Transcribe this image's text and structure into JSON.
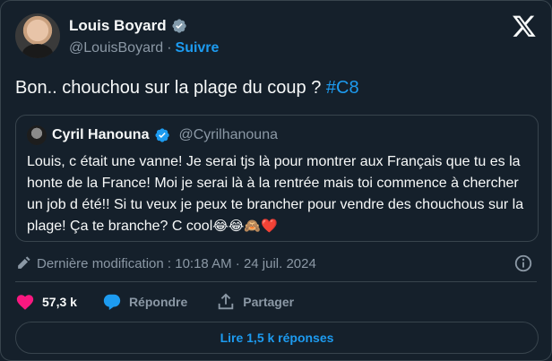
{
  "author": {
    "display_name": "Louis Boyard",
    "handle": "@LouisBoyard",
    "separator": "·",
    "follow_label": "Suivre"
  },
  "tweet": {
    "text": "Bon.. chouchou sur la plage du coup ? ",
    "hashtag": "#C8"
  },
  "quote": {
    "display_name": "Cyril Hanouna",
    "handle": "@Cyrilhanouna",
    "text": "Louis, c était une vanne! Je serai tjs là pour montrer aux Français que tu es la honte de la France! Moi je serai là à la rentrée mais toi commence à chercher un job d été!! Si tu veux je peux te brancher pour vendre des chouchous sur la plage! Ça te branche? C cool",
    "emojis": [
      "😂",
      "😂",
      "🙈",
      "❤️"
    ]
  },
  "meta": {
    "edited_text": "Dernière modification : 10:18 AM · 24 juil. 2024"
  },
  "actions": {
    "likes": "57,3 k",
    "reply_label": "Répondre",
    "share_label": "Partager"
  },
  "read_replies_label": "Lire 1,5 k réponses",
  "colors": {
    "background": "#15202b",
    "border": "#38444d",
    "accent": "#1d9bf0",
    "like": "#f91880",
    "muted": "#8b98a5"
  },
  "icons": [
    "verified-badge-icon",
    "x-logo-icon",
    "pencil-icon",
    "info-icon",
    "heart-icon",
    "reply-bubble-icon",
    "share-icon"
  ]
}
